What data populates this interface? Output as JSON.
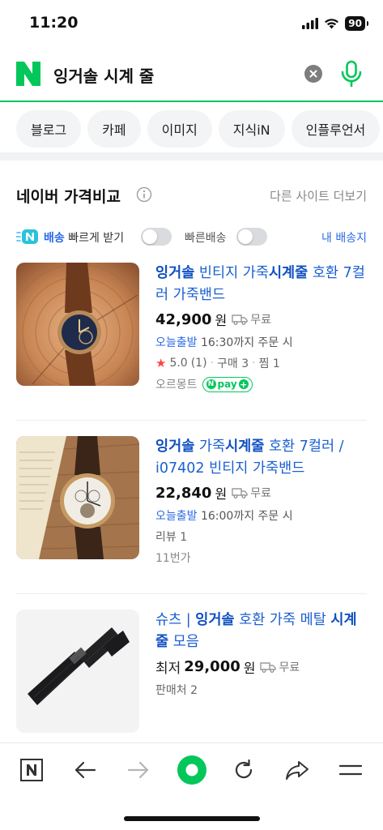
{
  "status_bar": {
    "time": "11:20",
    "battery": "90"
  },
  "search": {
    "query": "잉거솔 시계 줄"
  },
  "chips": [
    "블로그",
    "카페",
    "이미지",
    "지식iN",
    "인플루언서"
  ],
  "section": {
    "title": "네이버 가격비교",
    "more_label": "다른 사이트 더보기"
  },
  "filters": {
    "fast_brand": "배송",
    "fast_label": "빠르게 받기",
    "quick_label": "빠른배송",
    "my_address": "내 배송지"
  },
  "products": [
    {
      "title_parts": [
        {
          "text": "잉거솔",
          "bold": true
        },
        {
          "text": " 빈티지 가죽",
          "bold": false
        },
        {
          "text": "시계줄",
          "bold": true
        },
        {
          "text": " 호환 7컬러 가죽밴드",
          "bold": false
        }
      ],
      "price": "42,900",
      "won": "원",
      "shipping": "무료",
      "delivery_today": "오늘출발",
      "delivery_note": "16:30까지 주문 시",
      "rating": "5.0",
      "rating_count": "(1)",
      "purchases": "구매 3",
      "wishes": "찜 1",
      "seller": "오르몽트",
      "npay": "pay"
    },
    {
      "title_parts": [
        {
          "text": "잉거솔",
          "bold": true
        },
        {
          "text": " 가죽",
          "bold": false
        },
        {
          "text": "시계줄",
          "bold": true
        },
        {
          "text": " 호환 7컬러 / i07402 빈티지 가죽밴드",
          "bold": false
        }
      ],
      "price": "22,840",
      "won": "원",
      "shipping": "무료",
      "delivery_today": "오늘출발",
      "delivery_note": "16:00까지 주문 시",
      "reviews": "리뷰 1",
      "seller": "11번가"
    },
    {
      "title_parts": [
        {
          "text": "슈츠 | ",
          "bold": false
        },
        {
          "text": "잉거솔",
          "bold": true
        },
        {
          "text": " 호환 가죽 메탈 ",
          "bold": false
        },
        {
          "text": "시계줄",
          "bold": true
        },
        {
          "text": " 모음",
          "bold": false
        }
      ],
      "price_prefix": "최저",
      "price": "29,000",
      "won": "원",
      "shipping": "무료",
      "sellers": "판매처 2"
    }
  ],
  "colors": {
    "naver_green": "#03c75a",
    "link_blue": "#1a5fd1"
  }
}
